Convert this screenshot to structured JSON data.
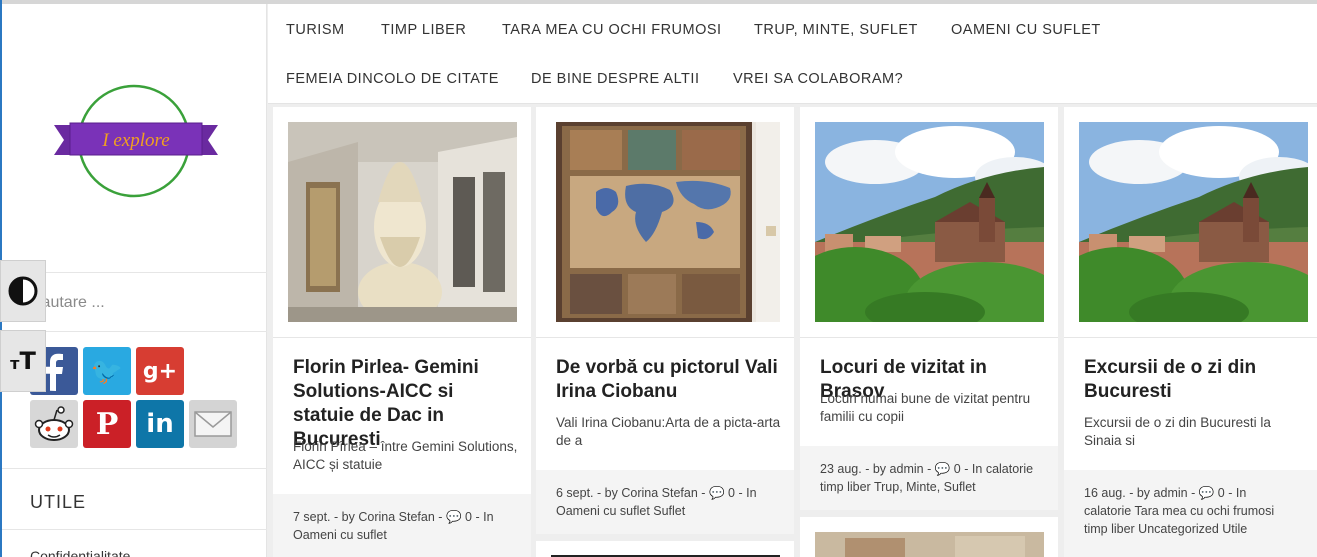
{
  "nav": {
    "items": [
      "TURISM",
      "TIMP LIBER",
      "TARA MEA CU OCHI FRUMOSI",
      "TRUP, MINTE, SUFLET",
      "OAMENI CU SUFLET",
      "FEMEIA DINCOLO DE CITATE",
      "DE BINE DESPRE ALTII",
      "VREI SA COLABORAM?"
    ]
  },
  "logo": {
    "text": "I explore"
  },
  "search": {
    "placeholder": "Cautare ..."
  },
  "a11y": {
    "contrast_label": "◑",
    "text_size_label": "тT"
  },
  "social": {
    "icons": [
      "facebook-icon",
      "twitter-icon",
      "google-plus-icon",
      "reddit-icon",
      "pinterest-icon",
      "linkedin-icon",
      "email-icon"
    ],
    "twitter_glyph": "🐦",
    "google_plus_glyph": "g+",
    "pinterest_glyph": "P",
    "linkedin_glyph": "in"
  },
  "sidebar": {
    "widget_title": "UTILE",
    "links": [
      "Confidentialitate"
    ]
  },
  "posts": [
    {
      "title": "Florin Pirlea- Gemini Solutions-AICC si statuie de Dac in Bucuresti",
      "excerpt": "Florin Pîrlea – între Gemini Solutions, AICC și statuie",
      "date": "7 sept.",
      "author": "Corina Stefan",
      "comments": "0",
      "categories": "Oameni cu suflet"
    },
    {
      "title": "De vorbă cu pictorul Vali Irina Ciobanu",
      "excerpt": "Vali Irina Ciobanu:Arta de a picta-arta de a",
      "date": "6 sept.",
      "author": "Corina Stefan",
      "comments": "0",
      "categories": "Oameni cu suflet Suflet"
    },
    {
      "title": "Locuri de vizitat in Brasov",
      "excerpt": "Locuri numai bune de vizitat pentru familii cu copii",
      "date": "23 aug.",
      "author": "admin",
      "comments": "0",
      "categories": "calatorie timp liber Trup, Minte, Suflet"
    },
    {
      "title": "Excursii de o zi din Bucuresti",
      "excerpt": "Excursii de o zi din Bucuresti la Sinaia si",
      "date": "16 aug.",
      "author": "admin",
      "comments": "0",
      "categories": "calatorie Tara mea cu ochi frumosi timp liber Uncategorized Utile"
    }
  ],
  "meta_words": {
    "by": "by",
    "in": "In",
    "sep": "-"
  },
  "colors": {
    "accent_blue": "#2b78c2",
    "logo_ribbon": "#6a2aa0",
    "logo_circle": "#3aa13a",
    "logo_text": "#f0a020"
  }
}
